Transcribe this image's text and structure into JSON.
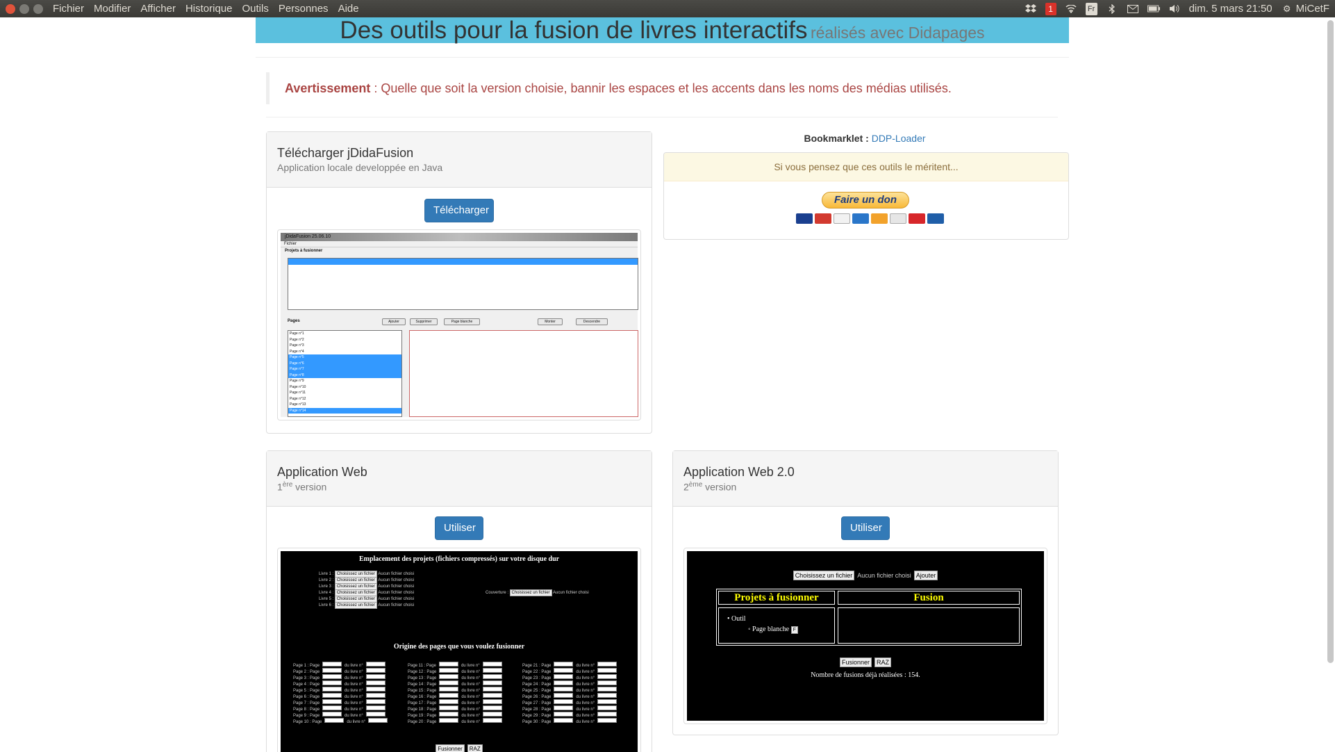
{
  "topbar": {
    "menu": [
      "Fichier",
      "Modifier",
      "Afficher",
      "Historique",
      "Outils",
      "Personnes",
      "Aide"
    ],
    "notification_count": "1",
    "keyboard": "Fr",
    "datetime": "dim. 5 mars 21:50",
    "user": "MiCetF"
  },
  "header": {
    "title": "Des outils pour la fusion de livres interactifs",
    "subtitle": "réalisés avec Didapages"
  },
  "warning": {
    "label": "Avertissement",
    "text": " : Quelle que soit la version choisie, bannir les espaces et les accents dans les noms des médias utilisés."
  },
  "jdida": {
    "title": "Télécharger jDidaFusion",
    "subtitle": "Application locale developpée en Java",
    "button": "Télécharger",
    "screenshot": {
      "window_title": "jDidaFusion 25.06.10",
      "menu": "Fichier",
      "projects_label": "Projets à fusionner",
      "pages_label": "Pages",
      "buttons": [
        "Ajouter",
        "Supprimer",
        "Page blanche",
        "Monter",
        "Descendre"
      ],
      "pages": [
        "Page n°1",
        "Page n°2",
        "Page n°3",
        "Page n°4",
        "Page n°5",
        "Page n°6",
        "Page n°7",
        "Page n°8",
        "Page n°9",
        "Page n°10",
        "Page n°11",
        "Page n°12",
        "Page n°13",
        "Page n°14"
      ]
    }
  },
  "bookmarklet": {
    "label": "Bookmarklet :",
    "link": "DDP-Loader"
  },
  "donate": {
    "heading": "Si vous pensez que ces outils le méritent...",
    "button": "Faire un don"
  },
  "web1": {
    "title": "Application Web",
    "sup_num": "1",
    "sup": "ère",
    "subtitle": " version",
    "button": "Utiliser",
    "screenshot": {
      "heading1": "Emplacement des projets (fichiers compressés) sur votre disque dur",
      "livres": [
        "Livre 1 :",
        "Livre 2 :",
        "Livre 3 :",
        "Livre 4 :",
        "Livre 5 :",
        "Livre 6 :"
      ],
      "choose": "Choisissez un fichier",
      "none": "Aucun fichier choisi",
      "couverture": "Couverture :",
      "heading2": "Origine des pages que vous voulez fusionner",
      "page_word": "Page",
      "from_book": "du livre n°",
      "fusionner": "Fusionner",
      "raz": "RAZ"
    }
  },
  "web2": {
    "title": "Application Web 2.0",
    "sup_num": "2",
    "sup": "ème",
    "subtitle": " version",
    "button": "Utiliser",
    "screenshot": {
      "choose": "Choisissez un fichier",
      "none": "Aucun fichier choisi",
      "add": "Ajouter",
      "col1": "Projets à fusionner",
      "col2": "Fusion",
      "item": "Outil",
      "subitem": "Page blanche",
      "fusionner": "Fusionner",
      "raz": "RAZ",
      "count": "Nombre de fusions déjà réalisées : 154."
    }
  },
  "colors": {
    "header_bg": "#5bc0de",
    "button": "#337ab7",
    "warning": "#a94442"
  }
}
